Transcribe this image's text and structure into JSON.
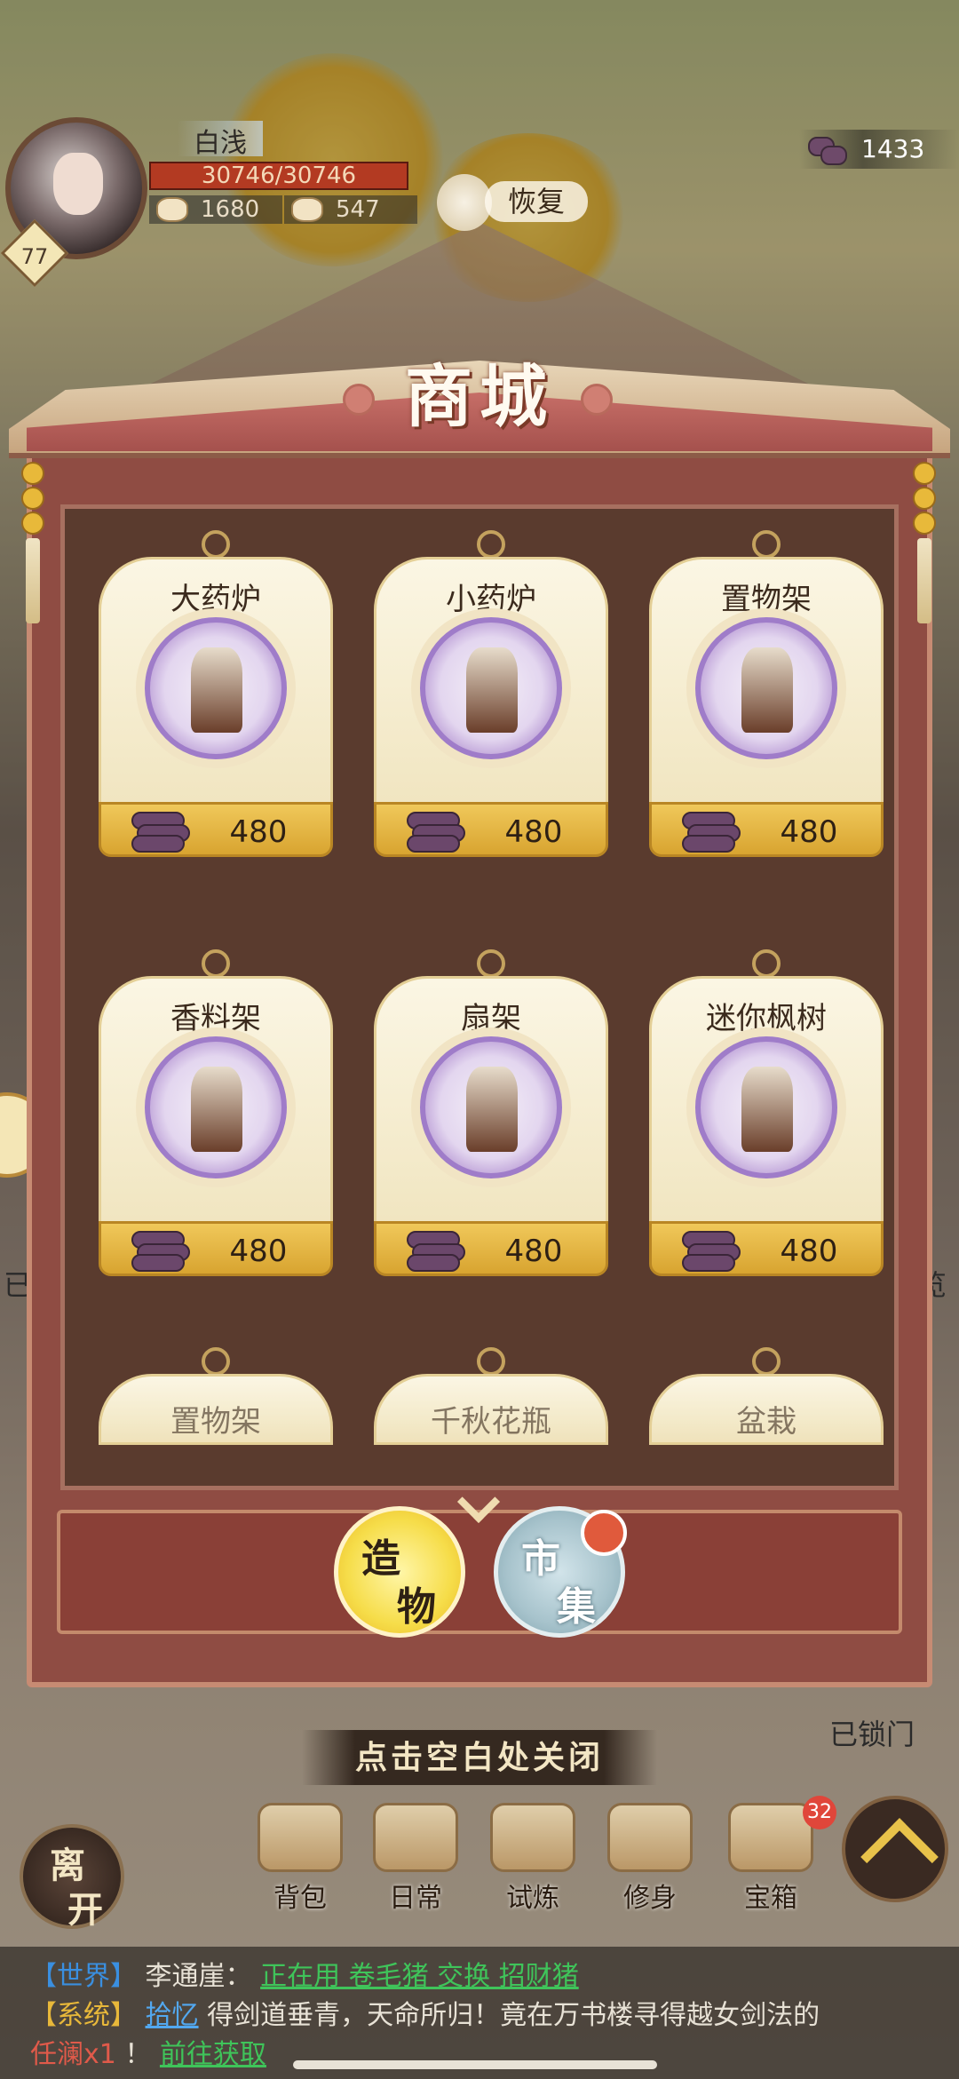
{
  "hud": {
    "player_name": "白浅",
    "level": "77",
    "hp": "30746/30746",
    "hp_fraction": 1.0,
    "resource_1": "1680",
    "resource_2": "547",
    "recover_label": "恢复",
    "currency": "1433"
  },
  "shop": {
    "title": "商城",
    "items": [
      {
        "name": "大药炉",
        "price": "480",
        "icon": "large-medicine-furnace"
      },
      {
        "name": "小药炉",
        "price": "480",
        "icon": "small-medicine-furnace"
      },
      {
        "name": "置物架",
        "price": "480",
        "icon": "shelf"
      },
      {
        "name": "香料架",
        "price": "480",
        "icon": "spice-rack"
      },
      {
        "name": "扇架",
        "price": "480",
        "icon": "fan-stand"
      },
      {
        "name": "迷你枫树",
        "price": "480",
        "icon": "mini-maple"
      },
      {
        "name": "置物架",
        "price": "",
        "icon": "shelf"
      },
      {
        "name": "千秋花瓶",
        "price": "",
        "icon": "vase"
      },
      {
        "name": "盆栽",
        "price": "",
        "icon": "bonsai"
      }
    ],
    "tabs": {
      "build": "造物",
      "market": "市集"
    }
  },
  "close_hint": "点击空白处关闭",
  "side": {
    "left_text": "已",
    "right_text": "览",
    "locked_door": "已锁门"
  },
  "nav": {
    "leave": "离开",
    "bag": "背包",
    "daily": "日常",
    "trial": "试炼",
    "cultivate": "修身",
    "treasure": "宝箱",
    "treasure_badge": "32"
  },
  "chat": {
    "line1_channel": "【世界】",
    "line1_user": "李通崖：",
    "line1_msg": "正在用 卷毛猪 交换 招财猪",
    "line2_channel": "【系统】",
    "line2_link": "拾忆",
    "line2_msg": "得剑道垂青，天命所归！竟在万书楼寻得越女剑法的",
    "line3_user": "任澜x1",
    "line3_sep": "！",
    "line3_link": "前往获取"
  },
  "colors": {
    "frame": "#8f4c43",
    "card_foot": "#d8a430",
    "icon_ring": "#9f7cc9"
  }
}
